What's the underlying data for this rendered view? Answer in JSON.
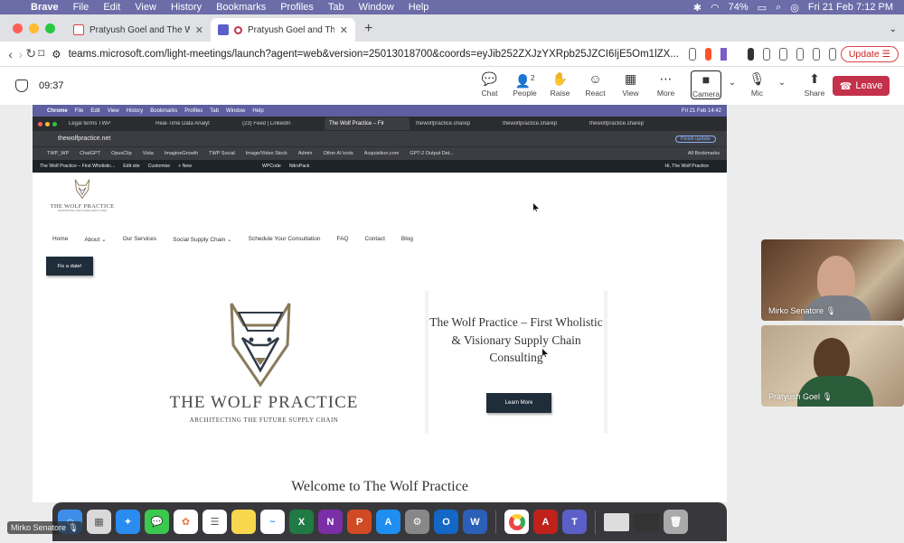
{
  "mac_menubar": {
    "app": "Brave",
    "menus": [
      "File",
      "Edit",
      "View",
      "History",
      "Bookmarks",
      "Profiles",
      "Tab",
      "Window",
      "Help"
    ],
    "battery": "74%",
    "datetime": "Fri 21 Feb  7:12 PM"
  },
  "browser": {
    "tabs": [
      {
        "title": "Pratyush Goel and The Wolf Prac",
        "active": false
      },
      {
        "title": "Pratyush Goel and The W",
        "active": true
      }
    ],
    "url": "teams.microsoft.com/light-meetings/launch?agent=web&version=25013018700&coords=eyJib252ZXJzYXRpb25JZCI6IjE5Om1lZX...",
    "update_label": "Update"
  },
  "teams": {
    "timer": "09:37",
    "toolbar": [
      {
        "label": "Chat",
        "icon": "chat-icon",
        "glyph": "💬"
      },
      {
        "label": "People",
        "icon": "people-icon",
        "glyph": "👤",
        "badge": "2"
      },
      {
        "label": "Raise",
        "icon": "raise-hand-icon",
        "glyph": "✋"
      },
      {
        "label": "React",
        "icon": "react-icon",
        "glyph": "☺"
      },
      {
        "label": "View",
        "icon": "view-icon",
        "glyph": "▦"
      },
      {
        "label": "More",
        "icon": "more-icon",
        "glyph": "⋯"
      }
    ],
    "camera_label": "Camera",
    "mic_label": "Mic",
    "share_label": "Share",
    "leave_label": "Leave",
    "leave_color": "#c4314b"
  },
  "shared_screen": {
    "menubar": {
      "app": "Chrome",
      "menus": [
        "File",
        "Edit",
        "View",
        "History",
        "Bookmarks",
        "Profiles",
        "Tab",
        "Window",
        "Help"
      ],
      "datetime": "Fri 21 Feb 14:42"
    },
    "tabs": [
      "Legal terms TWP",
      "Real-Time Data Analyt",
      "(23) Feed | LinkedIn",
      "The Wolf Practice – Fir",
      "thewolfpractice.sharep",
      "thewolfpractice.sharep",
      "thewolfpractice.sharep"
    ],
    "url": "thewolfpractice.net",
    "finish_update": "Finish update",
    "bookmarks": [
      "TWP_WP",
      "ChatGPT",
      "OpusClip",
      "Vista",
      "ImagineGrowth",
      "TWP Social",
      "Image/Video Stock",
      "Admin",
      "Other AI tools",
      "Acquisition.com",
      "GPT-2 Output Det..."
    ],
    "all_bookmarks": "All Bookmarks",
    "wp_bar": [
      "The Wolf Practice – First Wholistic...",
      "Edit site",
      "Customise",
      "+ New",
      "WPCode",
      "NitroPack"
    ],
    "wp_greeting": "Hi, The Wolf Practice",
    "site": {
      "logo_name": "THE WOLF PRACTICE",
      "logo_sub": "ARCHITECTING THE FUTURE SUPPLY CHAIN",
      "nav": [
        "Home",
        "About ⌄",
        "Our Services",
        "Social Supply Chain ⌄",
        "Schedule Your Consultation",
        "FAQ",
        "Contact",
        "Blog"
      ],
      "fix_button": "Fix a date!",
      "hero_name": "THE WOLF PRACTICE",
      "hero_sub": "ARCHITECTING THE FUTURE SUPPLY CHAIN",
      "hero_title": "The Wolf Practice – First Wholistic & Visionary Supply Chain Consulting",
      "learn_more": "Learn More",
      "welcome": "Welcome to The Wolf Practice"
    }
  },
  "participants": [
    {
      "name": "Mirko Senatore"
    },
    {
      "name": "Pratyush Goel"
    }
  ],
  "self_label": "Mirko Senatore"
}
